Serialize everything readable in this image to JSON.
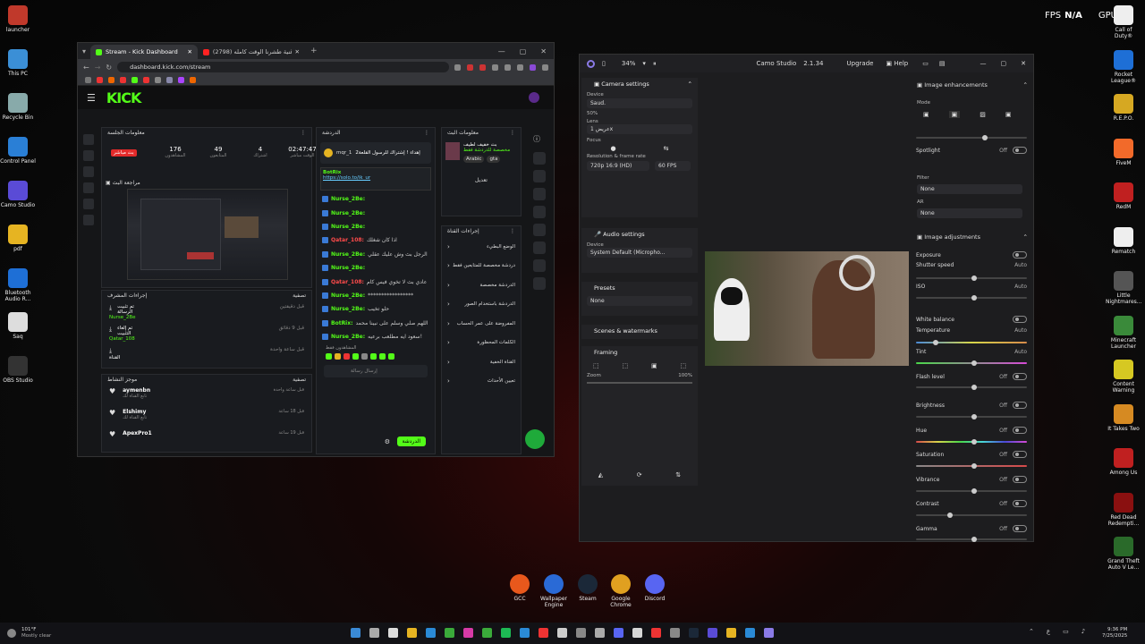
{
  "overlay": {
    "fps_label": "FPS",
    "fps_value": "N/A",
    "gpu_label": "GPU"
  },
  "desktop_left": [
    {
      "label": "launcher",
      "color": "#c0392b"
    },
    {
      "label": "This PC",
      "color": "#3b8fd6"
    },
    {
      "label": "Recycle Bin",
      "color": "#8aa"
    },
    {
      "label": "Control Panel",
      "color": "#2a7fd6"
    },
    {
      "label": "Camo Studio",
      "color": "#5a4bd6"
    },
    {
      "label": "pdf",
      "color": "#e6b422"
    },
    {
      "label": "Bluetooth Audio R...",
      "color": "#1e6fd6"
    },
    {
      "label": "Saq",
      "color": "#ddd"
    },
    {
      "label": "OBS Studio",
      "color": "#333"
    }
  ],
  "desktop_right": [
    {
      "label": "Call of Duty®",
      "color": "#eee"
    },
    {
      "label": "Rocket League®",
      "color": "#1e6fd6"
    },
    {
      "label": "R.E.P.O.",
      "color": "#d6a822"
    },
    {
      "label": "FiveM",
      "color": "#f26a2a"
    },
    {
      "label": "RedM",
      "color": "#c02020"
    },
    {
      "label": "Rematch",
      "color": "#eee"
    },
    {
      "label": "Little Nightmares...",
      "color": "#555"
    },
    {
      "label": "Minecraft Launcher",
      "color": "#3a8a3a"
    },
    {
      "label": "Content Warning",
      "color": "#d6c822"
    },
    {
      "label": "It Takes Two",
      "color": "#d68a22"
    },
    {
      "label": "Among Us",
      "color": "#c02020"
    },
    {
      "label": "Red Dead Redempti...",
      "color": "#8a1010"
    },
    {
      "label": "Grand Theft Auto V Le...",
      "color": "#2a6a2a"
    }
  ],
  "browser": {
    "tabs": [
      {
        "title": "Stream - Kick Dashboard",
        "color": "#53fc18"
      },
      {
        "title": "اغنية طشرنا الوقت كامله (2798)",
        "color": "#ff2222"
      }
    ],
    "url": "dashboard.kick.com/stream",
    "logo": "KICK"
  },
  "kick": {
    "session": {
      "title": "معلومات الجلسة",
      "live_badge": "بث مباشر",
      "stats": [
        {
          "value": "176",
          "label": "المشاهدون"
        },
        {
          "value": "49",
          "label": "المتابعون"
        },
        {
          "value": "4",
          "label": "اشتراك"
        },
        {
          "value": "02:47:47",
          "label": "الوقت مباشر"
        }
      ],
      "preview_title": "مراجعة البث"
    },
    "mod_actions": {
      "title": "إجراءات المشرف",
      "filter": "تصفية",
      "items": [
        {
          "action": "تم تثبيت الرسالة",
          "by": "Nurse_2Be",
          "time": "قبل دقيقتين"
        },
        {
          "action": "تم إلغاء التثبيت",
          "by": "Qatar_108",
          "time": "قبل 9 دقائق"
        },
        {
          "action": "القناة",
          "by": "",
          "time": "قبل ساعة واحدة"
        }
      ]
    },
    "activity": {
      "title": "موجز النشاط",
      "filter": "تصفية",
      "items": [
        {
          "name": "aymenbn",
          "sub": "تابع القناة لك",
          "time": "قبل ساعة واحدة"
        },
        {
          "name": "Elshimy",
          "sub": "تابع القناة لك",
          "time": "قبل 18 ساعة"
        },
        {
          "name": "ApexPro1",
          "sub": "",
          "time": "قبل 19 ساعة"
        }
      ]
    },
    "chat": {
      "title": "الدردشة",
      "pinned_user": "mqr_1",
      "pinned_text": "إهداء ! إشتراك للرسول القلعة2",
      "link_user": "BotRix",
      "link": "https://solo.to/ik_ur",
      "lines": [
        {
          "user": "Nurse_2Be:",
          "msg": "",
          "red": false
        },
        {
          "user": "Nurse_2Be:",
          "msg": "",
          "red": false
        },
        {
          "user": "Nurse_2Be:",
          "msg": "",
          "red": false
        },
        {
          "user": "Qatar_108:",
          "msg": "اذا كان شغلك",
          "red": true
        },
        {
          "user": "Nurse_2Be:",
          "msg": "الرجل بث وش عليك عقلي",
          "red": false
        },
        {
          "user": "Nurse_2Be:",
          "msg": "",
          "red": false
        },
        {
          "user": "Qatar_108:",
          "msg": "عادي بث لا تخوي فيس كام",
          "red": true
        },
        {
          "user": "Nurse_2Be:",
          "msg": "*****************",
          "red": false
        },
        {
          "user": "Nurse_2Be:",
          "msg": "حلو تخيب",
          "red": false
        },
        {
          "user": "BotRix:",
          "msg": "اللهم صلي وسلم على نبينا محمد",
          "red": false
        },
        {
          "user": "Nurse_2Be:",
          "msg": "سعود ايه مطلعب برعيه!",
          "red": false
        }
      ],
      "viewers_label": "المشاهدون فقط",
      "input_placeholder": "إرسال رسالة",
      "send_label": "الدردشة"
    },
    "stream_info": {
      "title": "معلومات البث",
      "stream_title": "بث خفيف لطيف",
      "stream_sub": "مخصصة للدردشة فقط",
      "tags": [
        "Arabic",
        "gta"
      ],
      "edit_label": "تعديل"
    },
    "channel_actions": {
      "title": "إجراءات القناة",
      "items": [
        "الوضع البطيء",
        "دردشة مخصصة للمتابعين فقط",
        "الدردشة مخصصة",
        "الدردشة باستخدام الصور",
        "المفروضة على عمر الحساب",
        "الكلمات المحظورة",
        "القناة الخفية",
        "تعيين الأحداث"
      ]
    }
  },
  "camo": {
    "zoom": "34%",
    "app": "Camo Studio",
    "version": "2.1.34",
    "upgrade": "Upgrade",
    "help": "Help",
    "camera": {
      "title": "Camera settings",
      "device_label": "Device",
      "device": "Saud.",
      "battery": "50%",
      "lens_label": "Lens",
      "lens": "عريض 1x",
      "focus_label": "Focus",
      "res_label": "Resolution & frame rate",
      "res": "720p 16:9 (HD)",
      "fps": "60 FPS"
    },
    "audio": {
      "title": "Audio settings",
      "device_label": "Device",
      "device": "System Default (Micropho..."
    },
    "presets": {
      "title": "Presets",
      "value": "None"
    },
    "scenes": {
      "title": "Scenes & watermarks"
    },
    "framing": {
      "title": "Framing",
      "zoom_label": "Zoom",
      "zoom_value": "100%"
    },
    "enhance": {
      "title": "Image enhancements",
      "mode_label": "Mode",
      "spotlight": "Spotlight",
      "off": "Off",
      "filter_label": "Filter",
      "filter": "None",
      "ar_label": "AR",
      "ar": "None"
    },
    "adjust": {
      "title": "Image adjustments",
      "exposure": "Exposure",
      "shutter": "Shutter speed",
      "iso": "ISO",
      "auto": "Auto",
      "white_balance": "White balance",
      "temperature": "Temperature",
      "tint": "Tint",
      "flash": "Flash level",
      "brightness": "Brightness",
      "hue": "Hue",
      "saturation": "Saturation",
      "vibrance": "Vibrance",
      "contrast": "Contrast",
      "gamma": "Gamma",
      "off": "Off"
    }
  },
  "dock": [
    {
      "label": "GCC",
      "color": "#e8581c"
    },
    {
      "label": "Wallpaper Engine",
      "color": "#2a6ad6"
    },
    {
      "label": "Steam",
      "color": "#1b2838"
    },
    {
      "label": "Google Chrome",
      "color": "#e0a020"
    },
    {
      "label": "Discord",
      "color": "#5865f2"
    }
  ],
  "taskbar": {
    "temp": "101°F",
    "weather": "Mostly clear",
    "time": "9:36 PM",
    "date": "7/25/2025"
  }
}
